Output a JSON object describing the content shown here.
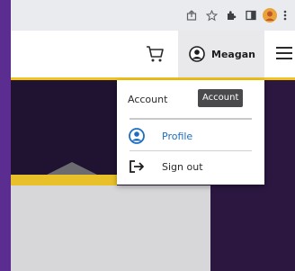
{
  "browser": {
    "toolbar_icons": [
      "share-icon",
      "star-icon",
      "extensions-icon",
      "sidepanel-icon",
      "profile-avatar-icon",
      "more-vert-icon"
    ]
  },
  "navbar": {
    "user_name": "Meagan",
    "cart_icon": "cart-icon",
    "menu_icon": "hamburger-menu-icon"
  },
  "dropdown": {
    "header_label": "Account",
    "tooltip": "Account",
    "items": [
      {
        "label": "Profile",
        "icon": "profile-icon"
      },
      {
        "label": "Sign out",
        "icon": "sign-out-icon"
      }
    ]
  },
  "colors": {
    "accent_yellow": "#f2c41b",
    "brand_purple": "#5c2d91",
    "link_blue": "#1b6ec2"
  }
}
